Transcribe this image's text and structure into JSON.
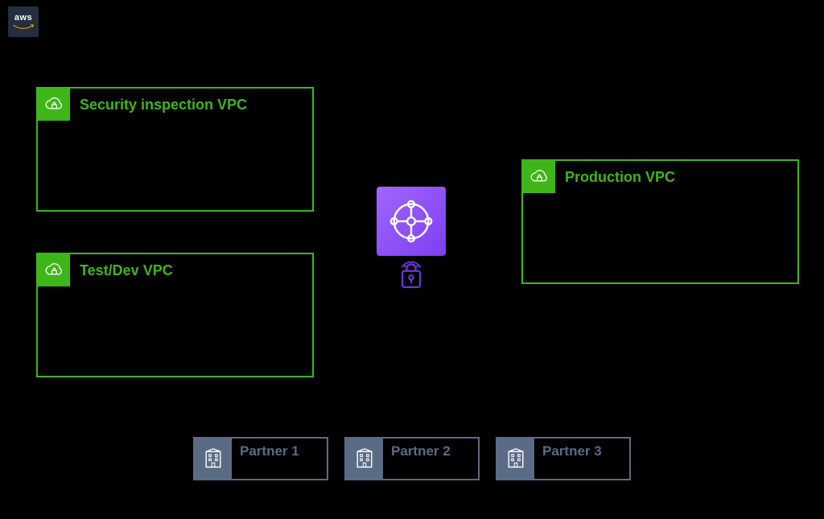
{
  "aws_logo": "aws",
  "vpcs": {
    "security": {
      "title": "Security inspection VPC"
    },
    "testdev": {
      "title": "Test/Dev VPC"
    },
    "prod": {
      "title": "Production VPC"
    }
  },
  "partners": [
    {
      "label": "Partner 1"
    },
    {
      "label": "Partner 2"
    },
    {
      "label": "Partner 3"
    }
  ]
}
